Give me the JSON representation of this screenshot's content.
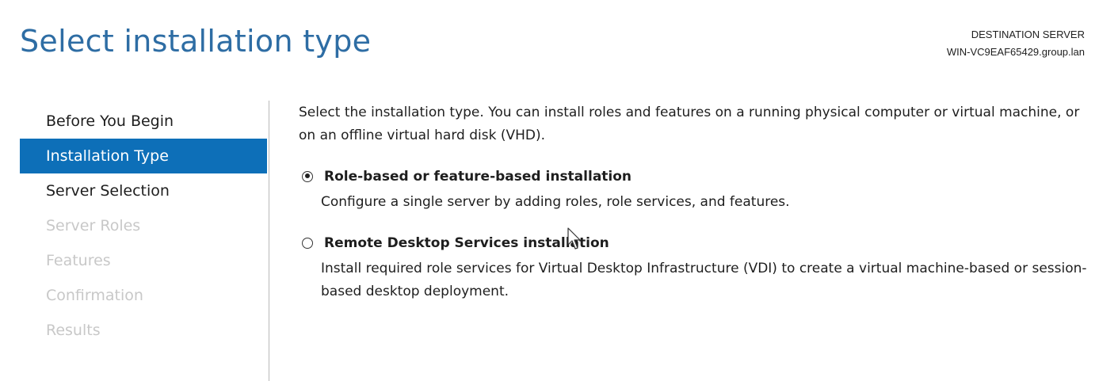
{
  "header": {
    "title": "Select installation type",
    "destination_label": "DESTINATION SERVER",
    "destination_server": "WIN-VC9EAF65429.group.lan"
  },
  "sidebar": {
    "items": [
      {
        "label": "Before You Begin",
        "state": "enabled"
      },
      {
        "label": "Installation Type",
        "state": "active"
      },
      {
        "label": "Server Selection",
        "state": "enabled"
      },
      {
        "label": "Server Roles",
        "state": "disabled"
      },
      {
        "label": "Features",
        "state": "disabled"
      },
      {
        "label": "Confirmation",
        "state": "disabled"
      },
      {
        "label": "Results",
        "state": "disabled"
      }
    ]
  },
  "main": {
    "intro": "Select the installation type. You can install roles and features on a running physical computer or virtual machine, or on an offline virtual hard disk (VHD).",
    "options": [
      {
        "label": "Role-based or feature-based installation",
        "description": "Configure a single server by adding roles, role services, and features.",
        "selected": true
      },
      {
        "label": "Remote Desktop Services installation",
        "description": "Install required role services for Virtual Desktop Infrastructure (VDI) to create a virtual machine-based or session-based desktop deployment.",
        "selected": false
      }
    ]
  },
  "colors": {
    "title": "#2e6da4",
    "active_nav": "#0d6fb8",
    "disabled_text": "#c8c8c8"
  }
}
